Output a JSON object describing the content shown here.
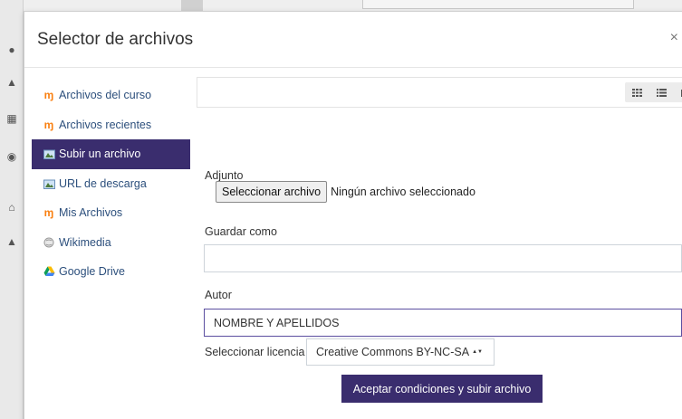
{
  "modal": {
    "title": "Selector de archivos",
    "close_label": "×"
  },
  "sidebar": {
    "items": [
      {
        "label": "Archivos del curso",
        "icon": "moodle-icon"
      },
      {
        "label": "Archivos recientes",
        "icon": "moodle-icon"
      },
      {
        "label": "Subir un archivo",
        "icon": "upload-icon",
        "active": true
      },
      {
        "label": "URL de descarga",
        "icon": "url-download-icon"
      },
      {
        "label": "Mis Archivos",
        "icon": "moodle-icon"
      },
      {
        "label": "Wikimedia",
        "icon": "wikimedia-icon"
      },
      {
        "label": "Google Drive",
        "icon": "google-drive-icon"
      }
    ]
  },
  "form": {
    "attachment_label": "Adjunto",
    "file_button_label": "Seleccionar archivo",
    "file_status": "Ningún archivo seleccionado",
    "save_as_label": "Guardar como",
    "save_as_value": "",
    "author_label": "Autor",
    "author_value": "NOMBRE Y APELLIDOS",
    "license_label": "Seleccionar licencia",
    "license_value": "Creative Commons BY-NC-SA",
    "submit_label": "Aceptar condiciones y subir archivo"
  },
  "colors": {
    "accent": "#3a2d6e",
    "moodle_orange": "#f98012",
    "link": "#2c4f7c"
  }
}
